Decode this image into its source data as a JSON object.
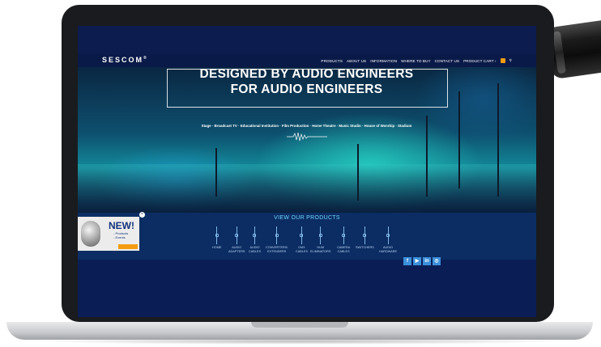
{
  "site": {
    "logo": "SESCOM",
    "logo_mark": "®"
  },
  "nav": {
    "items": [
      "PRODUCTS",
      "ABOUT US",
      "INFORMATION",
      "WHERE TO BUY",
      "CONTACT US",
      "PRODUCT CART ›"
    ],
    "icons": [
      "cart-badge-icon",
      "search-icon"
    ]
  },
  "hero": {
    "title_line1": "DESIGNED BY AUDIO ENGINEERS",
    "title_line2": "FOR AUDIO ENGINEERS",
    "subtitle": "Stage · Broadcast TV · Educational Institution · Film Production · Home Theatre · Music Studio · House of Worship · Stadium"
  },
  "products": {
    "title": "VIEW OUR PRODUCTS",
    "items": [
      {
        "label1": "HOME",
        "label2": ""
      },
      {
        "label1": "AUDIO",
        "label2": "ADAPTERS"
      },
      {
        "label1": "AUDIO",
        "label2": "CABLES"
      },
      {
        "label1": "CONVERTERS/",
        "label2": "EXTENDERS"
      },
      {
        "label1": "DMX",
        "label2": "CABLES"
      },
      {
        "label1": "HUM",
        "label2": "ELIMINATORS"
      },
      {
        "label1": "CAMERA",
        "label2": "CABLES"
      },
      {
        "label1": "SWITCHERS",
        "label2": ""
      },
      {
        "label1": "AUDIO",
        "label2": "HARDWARE"
      }
    ]
  },
  "promo": {
    "badge": "NEW!",
    "items": [
      "- Products",
      "- Events"
    ]
  },
  "social": {
    "icons": [
      "f",
      "▶",
      "in",
      "◎"
    ]
  },
  "colors": {
    "page_bg": "#0b1a4a",
    "products_bg": "#0b2d63",
    "accent_cyan": "#6fd3ff",
    "cart_orange": "#f39c12"
  }
}
